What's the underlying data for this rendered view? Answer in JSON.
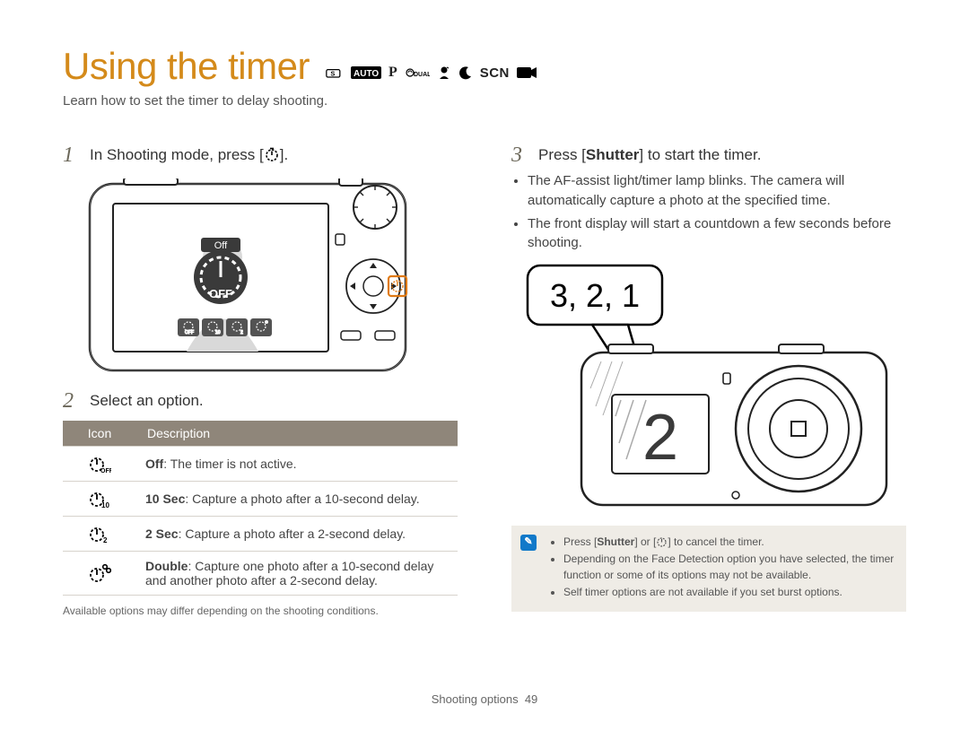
{
  "title": "Using the timer",
  "mode_icons": [
    "S-mode",
    "AUTO-mode",
    "P-mode",
    "DUAL-mode",
    "beauty-mode",
    "night-mode",
    "SCN-mode",
    "movie-mode"
  ],
  "subtitle": "Learn how to set the timer to delay shooting.",
  "steps": {
    "s1": {
      "num": "1",
      "pre": "In Shooting mode, press [",
      "post": "]."
    },
    "s2": {
      "num": "2",
      "text": "Select an option."
    },
    "s3": {
      "num": "3",
      "pre": "Press [",
      "btn": "Shutter",
      "post": "] to start the timer."
    }
  },
  "camera_back": {
    "off_label": "Off",
    "off_big": "OFF"
  },
  "table": {
    "head_icon": "Icon",
    "head_desc": "Description",
    "rows": [
      {
        "icon_name": "timer-off-icon",
        "label": "Off",
        "desc": ": The timer is not active."
      },
      {
        "icon_name": "timer-10-icon",
        "label": "10 Sec",
        "desc": ": Capture a photo after a 10-second delay."
      },
      {
        "icon_name": "timer-2-icon",
        "label": "2 Sec",
        "desc": ": Capture a photo after a 2-second delay."
      },
      {
        "icon_name": "timer-double-icon",
        "label": "Double",
        "desc": ": Capture one photo after a 10-second delay and another photo after a 2-second delay."
      }
    ]
  },
  "footnote": "Available options may differ depending on the shooting conditions.",
  "right_bullets": [
    "The AF-assist light/timer lamp blinks. The camera will automatically capture a photo at the specified time.",
    "The front display will start a countdown a few seconds before shooting."
  ],
  "countdown_bubble": "3, 2, 1",
  "front_display_number": "2",
  "note": {
    "items": {
      "i1": {
        "pre": "Press [",
        "btn": "Shutter",
        "mid": "] or [",
        "post": "] to cancel the timer."
      },
      "i2": "Depending on the Face Detection option you have selected, the timer function or some of its options may not be available.",
      "i3": "Self timer options are not available if you set burst options."
    }
  },
  "footer": {
    "section": "Shooting options",
    "page": "49"
  }
}
